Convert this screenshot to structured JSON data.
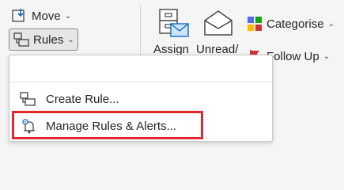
{
  "ribbon": {
    "move_label": "Move",
    "rules_label": "Rules",
    "assign_label": "Assign",
    "unread_label": "Unread/",
    "categorise_label": "Categorise",
    "followup_label": "Follow Up"
  },
  "rules_menu": {
    "items": [
      {
        "label": "Create Rule..."
      },
      {
        "label": "Manage Rules & Alerts..."
      }
    ]
  },
  "colors": {
    "highlight": "#e0282e",
    "accent_blue": "#0f6cbd",
    "followup_red": "#d13438"
  }
}
